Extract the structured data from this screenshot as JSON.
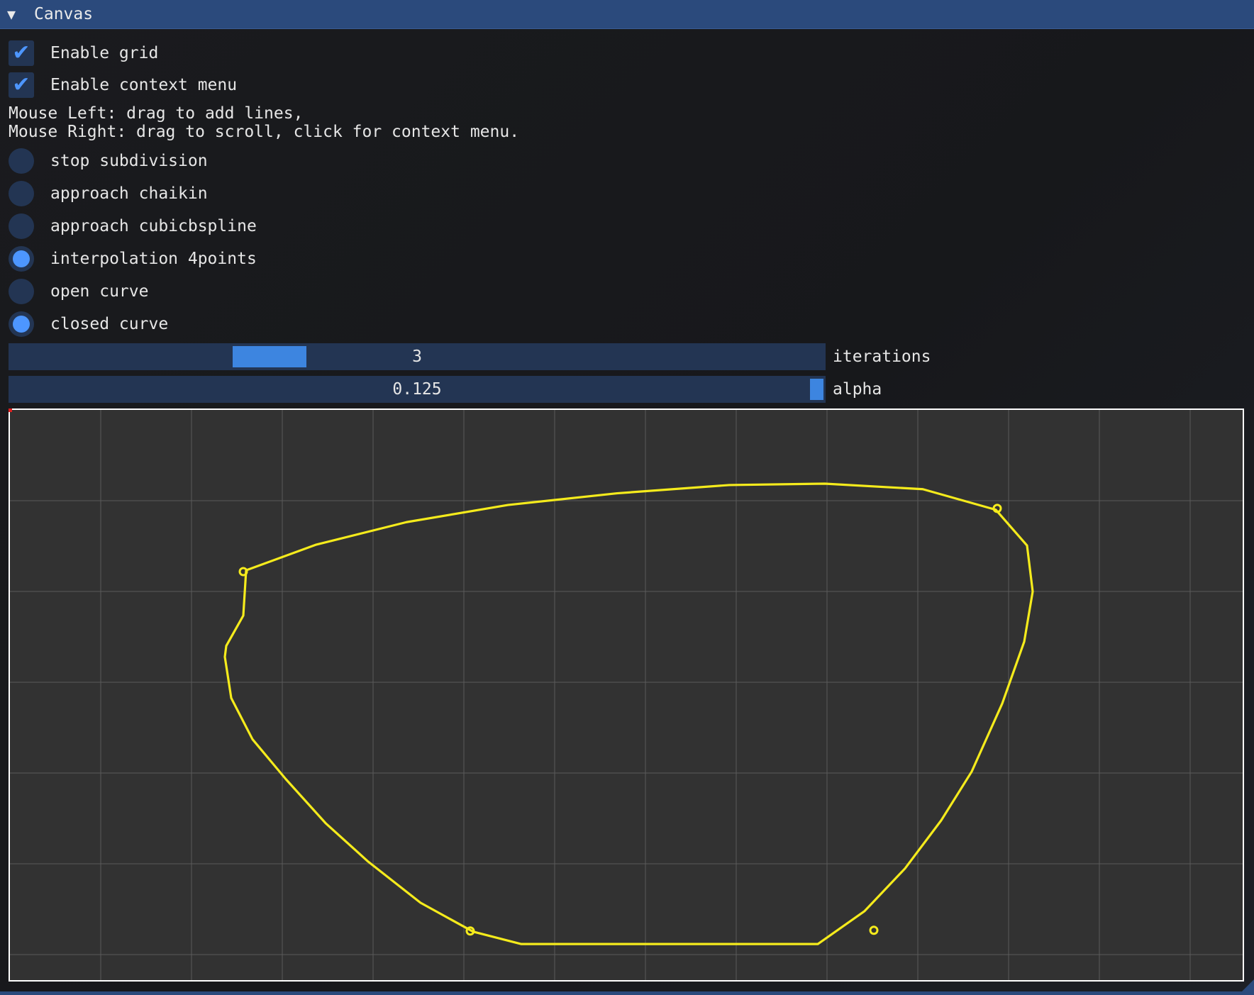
{
  "window": {
    "title": "Canvas",
    "collapse_icon": "triangle-down"
  },
  "checkboxes": [
    {
      "label": "Enable grid",
      "checked": true
    },
    {
      "label": "Enable context menu",
      "checked": true
    }
  ],
  "help": {
    "line1": "Mouse Left: drag to add lines,",
    "line2": "Mouse Right: drag to scroll, click for context menu."
  },
  "radios": [
    {
      "label": "stop subdivision",
      "selected": false
    },
    {
      "label": "approach chaikin",
      "selected": false
    },
    {
      "label": "approach cubicbspline",
      "selected": false
    },
    {
      "label": "interpolation 4points",
      "selected": true
    },
    {
      "label": "open curve",
      "selected": false
    },
    {
      "label": "closed curve",
      "selected": true
    }
  ],
  "sliders": {
    "iterations": {
      "value": "3",
      "label": "iterations",
      "fraction": 0.32
    },
    "alpha": {
      "value": "0.125",
      "label": "alpha",
      "fraction": 1.0
    }
  },
  "colors": {
    "curve": "#f5eb1c",
    "accent": "#4d96ff",
    "frame": "#233553",
    "title_bar": "#2b4a7c",
    "canvas_bg": "#323232",
    "grid": "#5a5a5a"
  }
}
